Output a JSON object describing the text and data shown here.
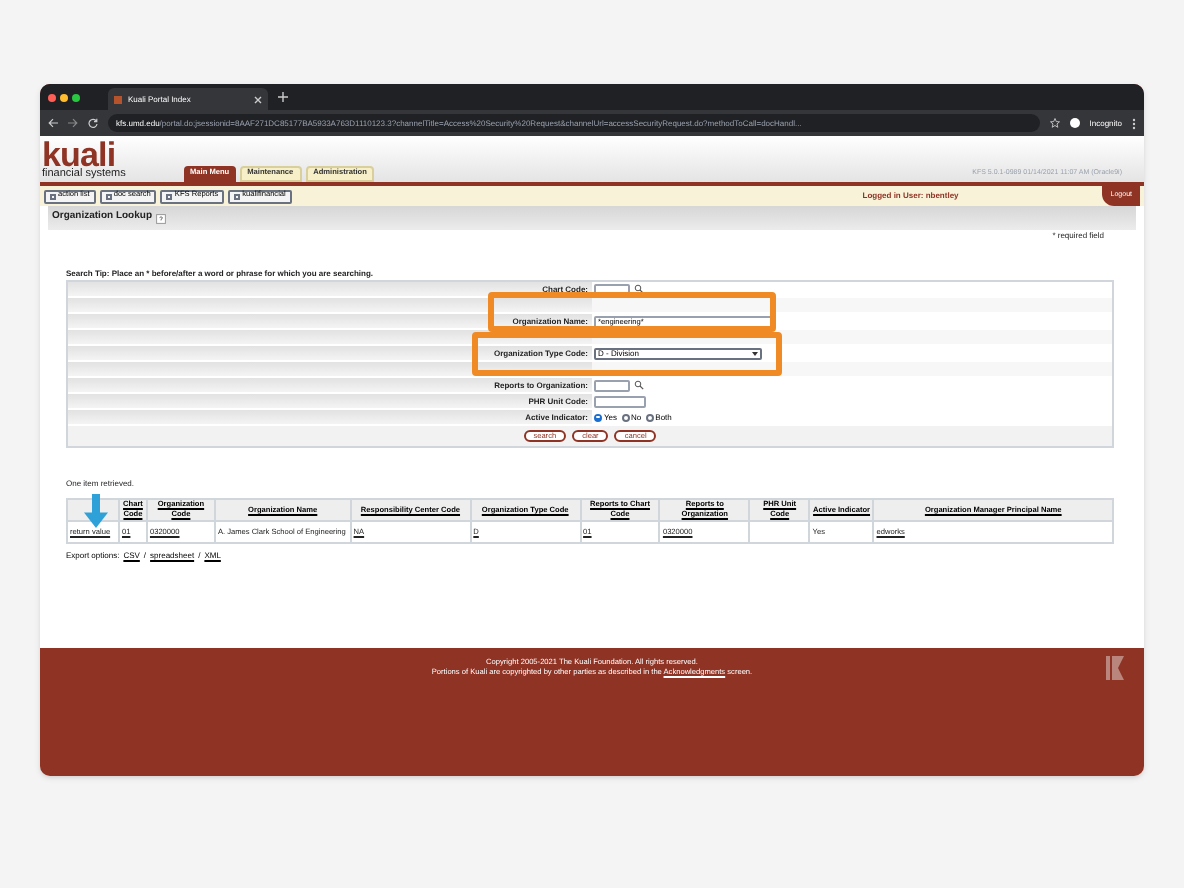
{
  "browser": {
    "tab_title": "Kuali Portal Index",
    "url_host": "kfs.umd.edu",
    "url_rest": "/portal.do;jsessionid=8AAF271DC85177BA5933A763D1110123.3?channelTitle=Access%20Security%20Request&channelUrl=accessSecurityRequest.do?methodToCall=docHandl...",
    "profile": "Incognito"
  },
  "header": {
    "logo": "kuali",
    "tagline": "financial systems",
    "version": "KFS 5.0.1-0989 01/14/2021 11:07 AM (Oracle9i)",
    "tabs": [
      {
        "label": "Main Menu",
        "selected": true
      },
      {
        "label": "Maintenance",
        "selected": false
      },
      {
        "label": "Administration",
        "selected": false
      }
    ]
  },
  "toolbar": {
    "buttons": [
      "action list",
      "doc search",
      "KFS Reports",
      "kualifinancial"
    ],
    "user": "Logged in User: nbentley",
    "logout": "Logout"
  },
  "page": {
    "title": "Organization Lookup",
    "required": "* required field",
    "tip": "Search Tip: Place an * before/after a word or phrase for which you are searching."
  },
  "fields": [
    {
      "kind": "text",
      "label": "Chart Code:",
      "lookup": true
    },
    {
      "kind": "blank"
    },
    {
      "kind": "text",
      "label": "Organization Name:",
      "value": "*engineering*",
      "lookup": false
    },
    {
      "kind": "blank"
    },
    {
      "kind": "select",
      "label": "Organization Type Code:",
      "value": "D - Division"
    },
    {
      "kind": "blank"
    },
    {
      "kind": "text",
      "label": "Reports to Organization:",
      "lookup": true
    },
    {
      "kind": "text",
      "label": "PHR Unit Code:",
      "lookup": false
    },
    {
      "kind": "radio",
      "label": "Active Indicator:",
      "options": [
        {
          "label": "Yes",
          "selected": true
        },
        {
          "label": "No",
          "selected": false
        },
        {
          "label": "Both",
          "selected": false
        }
      ]
    }
  ],
  "form_buttons": [
    "search",
    "clear",
    "cancel"
  ],
  "results": {
    "message": "One item retrieved.",
    "columns": [
      "",
      "Chart Code",
      "Organization Code",
      "Organization Name",
      "Responsibility Center Code",
      "Organization Type Code",
      "Reports to Chart Code",
      "Reports to Organization",
      "PHR Unit Code",
      "Active Indicator",
      "Organization Manager Principal Name"
    ],
    "rows": [
      [
        {
          "text": "return value",
          "link": true
        },
        {
          "text": "01",
          "link": true
        },
        {
          "text": "0320000",
          "link": true
        },
        {
          "text": "A. James Clark School of Engineering",
          "link": false
        },
        {
          "text": "NA",
          "link": true
        },
        {
          "text": "D",
          "link": true
        },
        {
          "text": "01",
          "link": true
        },
        {
          "text": "0320000",
          "link": true
        },
        null,
        {
          "text": "Yes",
          "link": false
        },
        {
          "text": "edworks",
          "link": true
        }
      ]
    ],
    "export_label": "Export options:",
    "export_separator": "/",
    "export_links": [
      "CSV",
      "spreadsheet",
      "XML"
    ]
  },
  "footer": {
    "copyright": "Copyright 2005-2021 The Kuali Foundation. All rights reserved.",
    "portions_before": "Portions of Kuali are copyrighted by other parties as described in the",
    "portions_link": "Acknowledgments",
    "portions_after": "screen."
  }
}
